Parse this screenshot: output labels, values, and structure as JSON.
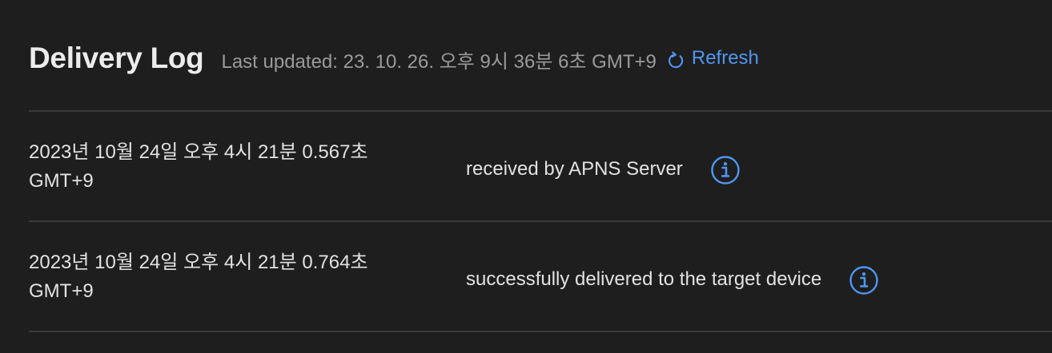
{
  "header": {
    "title": "Delivery Log",
    "last_updated": "Last updated: 23. 10. 26. 오후 9시 36분 6초 GMT+9",
    "refresh_label": "Refresh",
    "refresh_icon": "refresh-icon"
  },
  "colors": {
    "background": "#1e1e1e",
    "accent": "#4f96f0",
    "divider": "#3a3a3a"
  },
  "log": [
    {
      "timestamp": "2023년 10월 24일 오후 4시 21분 0.567초 GMT+9",
      "status": "received by APNS Server",
      "icon": "info-icon"
    },
    {
      "timestamp": "2023년 10월 24일 오후 4시 21분 0.764초 GMT+9",
      "status": "successfully delivered to the target device",
      "icon": "info-icon"
    }
  ]
}
